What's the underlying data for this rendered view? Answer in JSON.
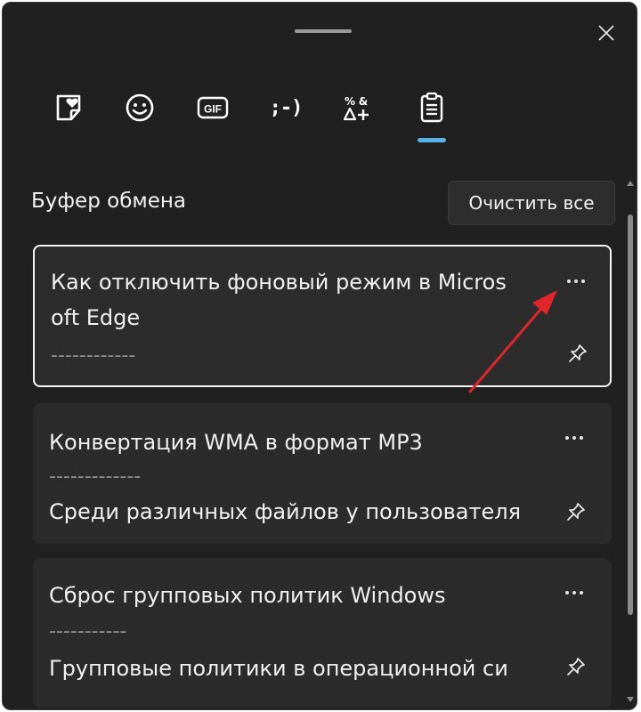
{
  "window": {
    "close_icon": "close-icon",
    "drag_handle_icon": "drag-handle"
  },
  "tabs": [
    {
      "name": "favorites",
      "icon": "heart-sticker-icon"
    },
    {
      "name": "emoji",
      "icon": "smiley-icon"
    },
    {
      "name": "gif",
      "icon": "gif-icon",
      "label": "GIF"
    },
    {
      "name": "kaomoji",
      "icon": "kaomoji-icon",
      "label": ";-)"
    },
    {
      "name": "symbols",
      "icon": "symbols-icon"
    },
    {
      "name": "clipboard",
      "icon": "clipboard-icon",
      "selected": true
    }
  ],
  "clipboard": {
    "title": "Буфер обмена",
    "clear_all_label": "Очистить все",
    "items": [
      {
        "line1": "Как отключить фоновый режим в Micros",
        "line2": "oft Edge",
        "dashes": "------------",
        "selected": true
      },
      {
        "line1": "Конвертация WMA в формат MP3",
        "dashes": "-------------",
        "line2": "Среди различных файлов у пользователя",
        "selected": false
      },
      {
        "line1": "Сброс групповых политик Windows",
        "dashes": "-----------",
        "line2": "Групповые политики в операционной си",
        "selected": false
      }
    ],
    "more_icon": "more-options-icon",
    "pin_icon": "pin-icon"
  },
  "colors": {
    "panel_bg": "#202020",
    "card_bg": "#2b2b2b",
    "accent": "#58b3e8",
    "arrow_annotation": "#e0252b"
  }
}
